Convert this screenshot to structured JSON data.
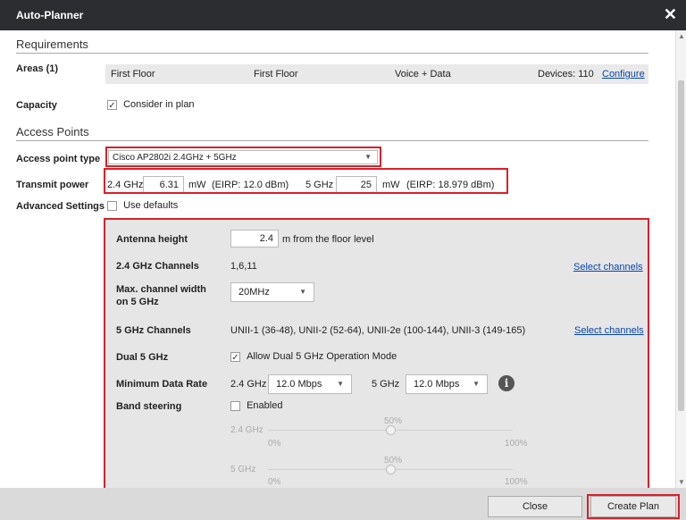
{
  "window": {
    "title": "Auto-Planner",
    "close_glyph": "✕"
  },
  "requirements": {
    "section_title": "Requirements",
    "areas_label": "Areas (1)",
    "area_row": {
      "building": "First Floor",
      "floor": "First Floor",
      "profile": "Voice + Data",
      "devices": "Devices: 110",
      "configure": "Configure"
    },
    "capacity_label": "Capacity",
    "consider_label": "Consider in plan",
    "consider_checked": "✓"
  },
  "access_points": {
    "section_title": "Access Points",
    "ap_type_label": "Access point type",
    "ap_type_value": "Cisco AP2802i 2.4GHz + 5GHz",
    "tx_label": "Transmit power",
    "tx_24_label": "2.4 GHz",
    "tx_24_value": "6.31",
    "tx_24_unit": "mW",
    "tx_24_eirp": "(EIRP: 12.0 dBm)",
    "tx_5_label": "5 GHz",
    "tx_5_value": "25",
    "tx_5_unit": "mW",
    "tx_5_eirp": "(EIRP: 18.979 dBm)",
    "adv_label": "Advanced Settings",
    "use_defaults": "Use defaults"
  },
  "advanced": {
    "antenna_label": "Antenna height",
    "antenna_value": "2.4",
    "antenna_suffix": "m from the floor level",
    "ch24_label": "2.4 GHz Channels",
    "ch24_value": "1,6,11",
    "select_channels": "Select channels",
    "maxwidth_label_1": "Max. channel width",
    "maxwidth_label_2": "on 5 GHz",
    "maxwidth_value": "20MHz",
    "ch5_label": "5 GHz Channels",
    "ch5_value": "UNII-1 (36-48), UNII-2 (52-64), UNII-2e (100-144), UNII-3 (149-165)",
    "dual5_label": "Dual 5 GHz",
    "dual5_text": "Allow Dual 5 GHz Operation Mode",
    "dual5_checked": "✓",
    "mindr_label": "Minimum Data Rate",
    "mindr_24_label": "2.4 GHz",
    "mindr_24_value": "12.0 Mbps",
    "mindr_5_label": "5 GHz",
    "mindr_5_value": "12.0 Mbps",
    "info_glyph": "i",
    "band_label": "Band steering",
    "band_enabled": "Enabled",
    "slider_24_label": "2.4 GHz",
    "slider_5_label": "5 GHz",
    "slider_24_pct": "50%",
    "slider_5_pct": "50%",
    "slider_min": "0%",
    "slider_max": "100%",
    "slider_24_level": 0.5,
    "slider_5_level": 0.5
  },
  "scrollbar": {
    "up_glyph": "▲",
    "down_glyph": "▼"
  },
  "footer": {
    "close": "Close",
    "create_plan": "Create Plan"
  },
  "colors": {
    "highlight": "#d9202a",
    "titlebar": "#2b2d30",
    "link": "#0645ad"
  }
}
